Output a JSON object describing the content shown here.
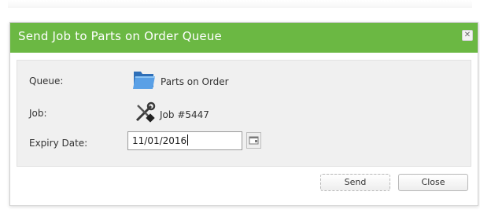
{
  "dialog": {
    "title": "Send Job to Parts on Order Queue",
    "close_icon": "close-icon",
    "colors": {
      "titlebar": "#6bb843",
      "title_text": "#ffffff",
      "content_bg": "#f0f0f0"
    }
  },
  "form": {
    "queue": {
      "label": "Queue:",
      "icon": "folder-icon",
      "value": "Parts on Order"
    },
    "job": {
      "label": "Job:",
      "icon": "tools-icon",
      "value": "Job #5447"
    },
    "expiry": {
      "label": "Expiry Date:",
      "value": "11/01/2016",
      "picker_icon": "calendar-icon"
    }
  },
  "footer": {
    "send_label": "Send",
    "close_label": "Close"
  }
}
